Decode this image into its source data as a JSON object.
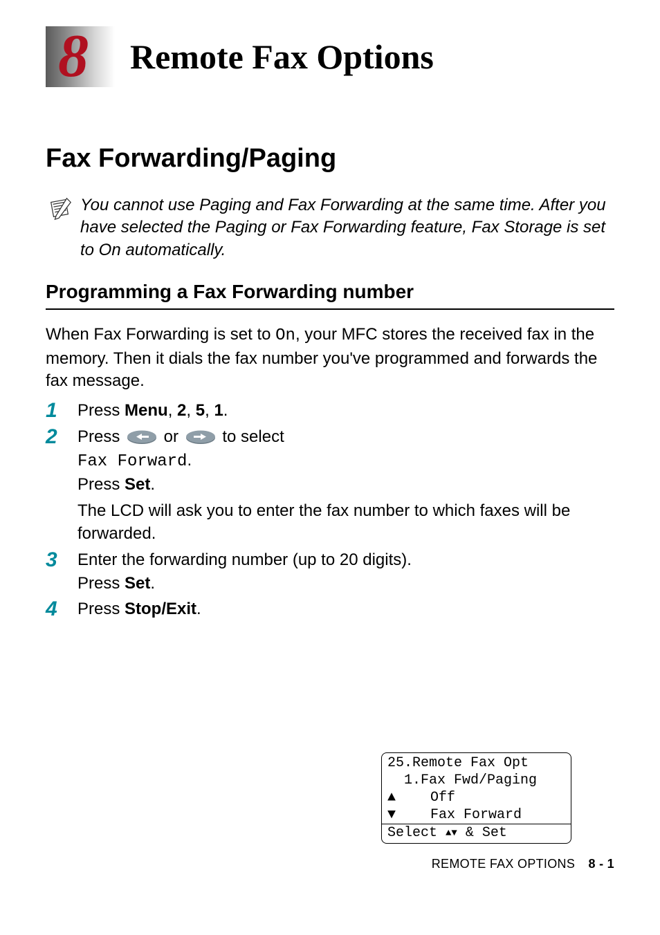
{
  "chapter": {
    "number": "8",
    "title": "Remote Fax Options"
  },
  "section": {
    "title": "Fax Forwarding/Paging"
  },
  "note": {
    "text": "You cannot use Paging and Fax Forwarding at the same time. After you have selected the Paging or Fax Forwarding feature, Fax Storage is set to On automatically."
  },
  "subsection": {
    "title": "Programming a Fax Forwarding number"
  },
  "intro": {
    "part1": "When Fax Forwarding is set to ",
    "mono": "On",
    "part2": ", your MFC stores the received fax in the memory. Then it dials the fax number you've programmed and forwards the fax message."
  },
  "steps": {
    "s1": {
      "num": "1",
      "press": "Press ",
      "menu": "Menu",
      "sep1": ", ",
      "k1": "2",
      "sep2": ", ",
      "k2": "5",
      "sep3": ", ",
      "k3": "1",
      "end": "."
    },
    "s2": {
      "num": "2",
      "press": "Press ",
      "or": " or ",
      "toselect": " to select",
      "mono": "Fax Forward",
      "dot": ".",
      "pressSet1": "Press ",
      "set1": "Set",
      "dot2": ".",
      "lcdNote": "The LCD will ask you to enter the fax number to which faxes will be forwarded."
    },
    "s3": {
      "num": "3",
      "line1": "Enter the forwarding number (up to 20 digits).",
      "press": "Press ",
      "set": "Set",
      "dot": "."
    },
    "s4": {
      "num": "4",
      "press": "Press ",
      "stopexit": "Stop/Exit",
      "dot": "."
    }
  },
  "lcd": {
    "line1": "25.Remote Fax Opt",
    "line2": "  1.Fax Fwd/Paging",
    "line3": "    Off",
    "line4": "    Fax Forward",
    "footerSelect": "Select ",
    "footerSet": " & Set"
  },
  "footer": {
    "label": "REMOTE FAX OPTIONS",
    "page": "8 - 1"
  }
}
